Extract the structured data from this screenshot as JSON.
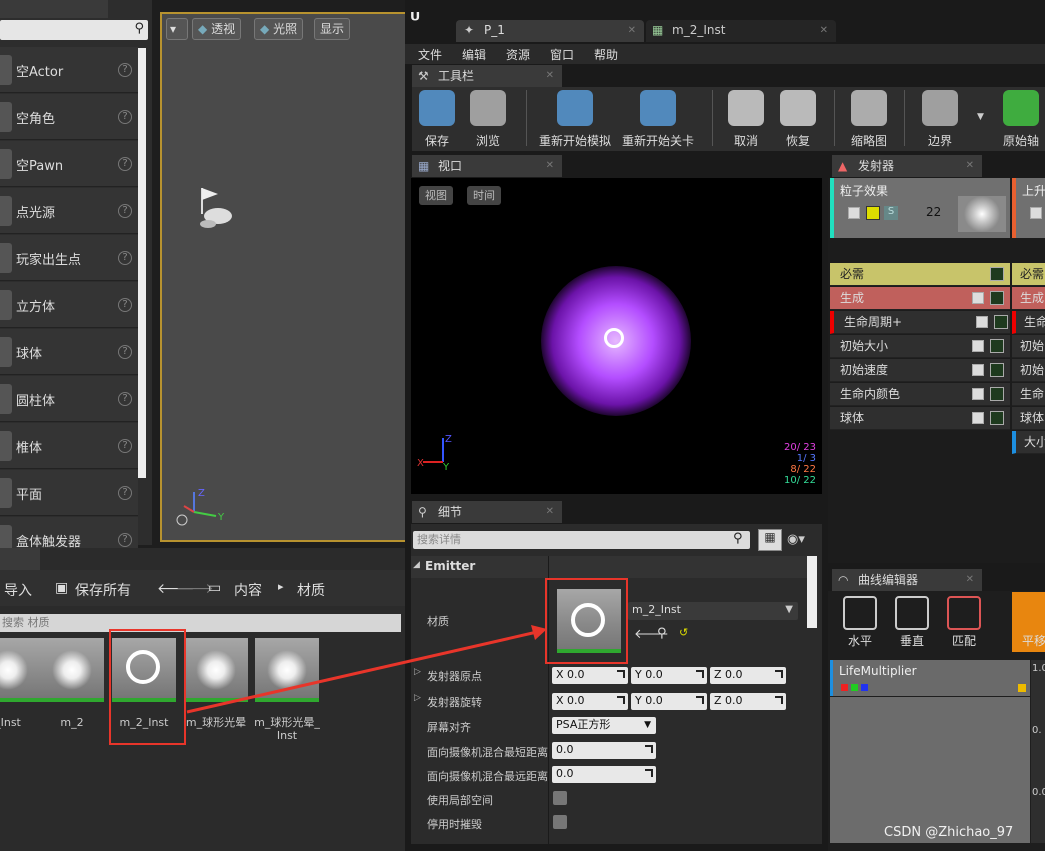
{
  "place_items": [
    "空Actor",
    "空角色",
    "空Pawn",
    "点光源",
    "玩家出生点",
    "立方体",
    "球体",
    "圆柱体",
    "椎体",
    "平面",
    "盒体触发器"
  ],
  "viewport": {
    "perspective": "透视",
    "lighting": "光照",
    "show": "显示"
  },
  "content_browser": {
    "import": "导入",
    "save_all": "保存所有",
    "crumb_content": "内容",
    "crumb_material": "材质",
    "search_placeholder": "搜索 材质",
    "assets": [
      {
        "label": "_Inst"
      },
      {
        "label": "m_2"
      },
      {
        "label": "m_2_Inst"
      },
      {
        "label": "m_球形光晕"
      },
      {
        "label": "m_球形光晕_\nInst"
      }
    ]
  },
  "editor_tabs": [
    "P_1",
    "m_2_Inst"
  ],
  "menu": [
    "文件",
    "编辑",
    "资源",
    "窗口",
    "帮助"
  ],
  "toolbar": {
    "tab": "工具栏",
    "buttons": [
      "保存",
      "浏览",
      "重新开始模拟",
      "重新开始关卡",
      "取消",
      "恢复",
      "缩略图",
      "边界",
      "原始轴"
    ]
  },
  "viewport_panel": {
    "tab": "视口",
    "view_btn": "视图",
    "time_btn": "时间",
    "stats": [
      "20/ 23",
      "1/ 3",
      "8/ 22",
      "10/ 22"
    ],
    "axis": {
      "x": "X",
      "y": "Y",
      "z": "Z"
    }
  },
  "emitters": {
    "tab": "发射器",
    "name1": "粒子效果",
    "count": "22",
    "name2": "上升",
    "modules": [
      "必需",
      "生成",
      "生命周期+",
      "初始大小",
      "初始速度",
      "生命内颜色",
      "球体"
    ],
    "modules2": [
      "必需",
      "生成",
      "生命",
      "初始",
      "初始",
      "生命",
      "球体",
      "大小"
    ]
  },
  "details": {
    "tab": "细节",
    "search_placeholder": "搜索详情",
    "section": "Emitter",
    "material_label": "材质",
    "material_value": "m_2_Inst",
    "rows": [
      {
        "label": "发射器原点",
        "x": "X  0.0",
        "y": "Y  0.0",
        "z": "Z  0.0"
      },
      {
        "label": "发射器旋转",
        "x": "X  0.0",
        "y": "Y  0.0",
        "z": "Z  0.0"
      }
    ],
    "screen_align_label": "屏幕对齐",
    "screen_align_value": "PSA正方形",
    "min_dist_label": "面向摄像机混合最短距离",
    "min_dist_value": "0.0",
    "max_dist_label": "面向摄像机混合最远距离",
    "max_dist_value": "0.0",
    "local_space_label": "使用局部空间",
    "kill_label": "停用时摧毁"
  },
  "curve": {
    "tab": "曲线编辑器",
    "buttons": [
      "水平",
      "垂直",
      "匹配",
      "平移"
    ],
    "track": "LifeMultiplier",
    "ticks": [
      "1.0",
      "0.",
      "0.0"
    ]
  },
  "watermark": "CSDN @Zhichao_97",
  "colors": {
    "highlight": "#e8352a",
    "required": "#c8c46a",
    "spawn": "#c0605c",
    "accent": "#b8932f"
  }
}
